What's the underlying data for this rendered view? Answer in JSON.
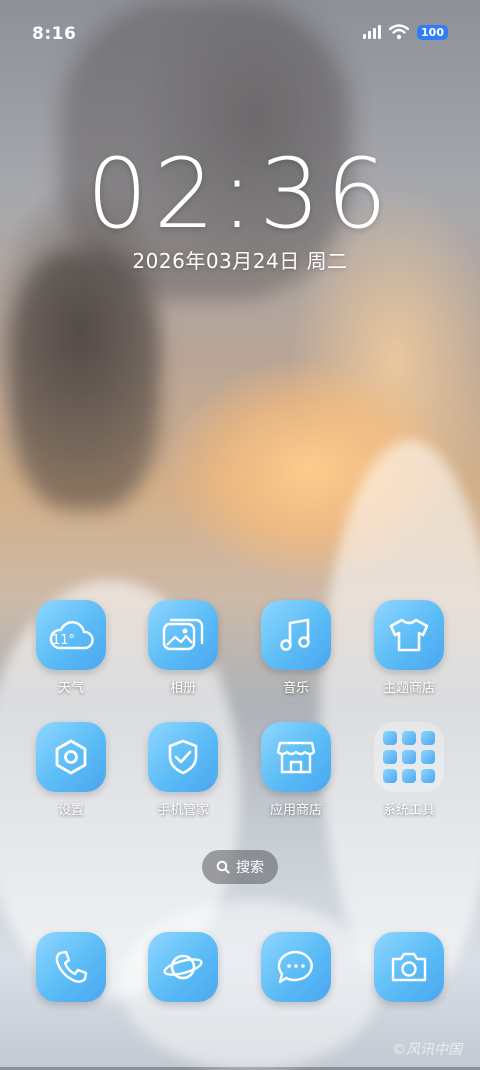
{
  "status_bar": {
    "time": "8:16",
    "battery": "100"
  },
  "lock": {
    "clock": "02:36",
    "date": "2026年03月24日  周二"
  },
  "apps": [
    {
      "label": "天气",
      "icon": "weather-cloud-icon",
      "temp": "11°"
    },
    {
      "label": "相册",
      "icon": "gallery-icon"
    },
    {
      "label": "音乐",
      "icon": "music-note-icon"
    },
    {
      "label": "主题商店",
      "icon": "tshirt-icon"
    },
    {
      "label": "设置",
      "icon": "settings-hex-icon"
    },
    {
      "label": "手机管家",
      "icon": "shield-check-icon"
    },
    {
      "label": "应用商店",
      "icon": "store-icon"
    },
    {
      "label": "系统工具",
      "icon": "folder-icon"
    }
  ],
  "search": {
    "label": "搜索"
  },
  "dock": [
    {
      "icon": "phone-icon"
    },
    {
      "icon": "browser-planet-icon"
    },
    {
      "icon": "message-icon"
    },
    {
      "icon": "camera-icon"
    }
  ],
  "watermark": "©风讯中国"
}
